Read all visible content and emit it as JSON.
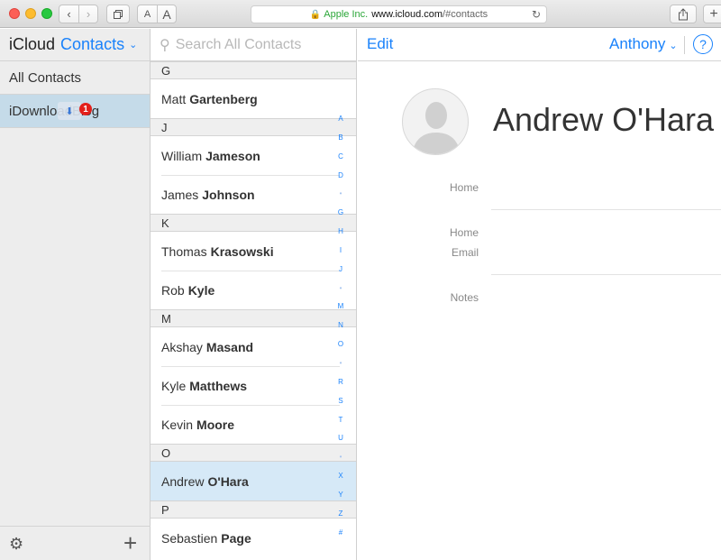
{
  "browser": {
    "nav_back": "‹",
    "nav_forward": "›",
    "tabs_icon": "tabs-icon",
    "font_small": "A",
    "font_large": "A",
    "url_company": "Apple Inc.",
    "url_domain": "www.icloud.com",
    "url_path": "/#contacts",
    "share_icon": "share-icon",
    "new_tab": "+"
  },
  "sidebar": {
    "brand": "iCloud",
    "app": "Contacts",
    "groups": [
      {
        "label": "All Contacts"
      },
      {
        "label": "iDownloadBlog"
      }
    ],
    "download_badge": "1"
  },
  "search": {
    "placeholder": "Search All Contacts"
  },
  "sections": [
    {
      "letter": "G",
      "contacts": [
        {
          "first": "Matt",
          "last": "Gartenberg"
        }
      ]
    },
    {
      "letter": "J",
      "contacts": [
        {
          "first": "William",
          "last": "Jameson"
        },
        {
          "first": "James",
          "last": "Johnson"
        }
      ]
    },
    {
      "letter": "K",
      "contacts": [
        {
          "first": "Thomas",
          "last": "Krasowski"
        },
        {
          "first": "Rob",
          "last": "Kyle"
        }
      ]
    },
    {
      "letter": "M",
      "contacts": [
        {
          "first": "Akshay",
          "last": "Masand"
        },
        {
          "first": "Kyle",
          "last": "Matthews"
        },
        {
          "first": "Kevin",
          "last": "Moore"
        }
      ]
    },
    {
      "letter": "O",
      "contacts": [
        {
          "first": "Andrew",
          "last": "O'Hara",
          "selected": true
        }
      ]
    },
    {
      "letter": "P",
      "contacts": [
        {
          "first": "Sebastien",
          "last": "Page"
        }
      ]
    }
  ],
  "index_letters": [
    "A",
    "B",
    "C",
    "D",
    "•",
    "G",
    "H",
    "I",
    "J",
    "•",
    "M",
    "N",
    "O",
    "•",
    "R",
    "S",
    "T",
    "U",
    "•",
    "X",
    "Y",
    "Z",
    "#"
  ],
  "detail": {
    "edit_label": "Edit",
    "user_name": "Anthony",
    "help_label": "?",
    "contact_name": "Andrew O'Hara",
    "fields": {
      "phone_label": "Home",
      "email_label_1": "Home",
      "email_label_2": "Email",
      "notes_label": "Notes"
    }
  },
  "colors": {
    "accent": "#1a82fb",
    "selected_row": "#d6e9f7",
    "selected_group": "#c5dbe9"
  }
}
